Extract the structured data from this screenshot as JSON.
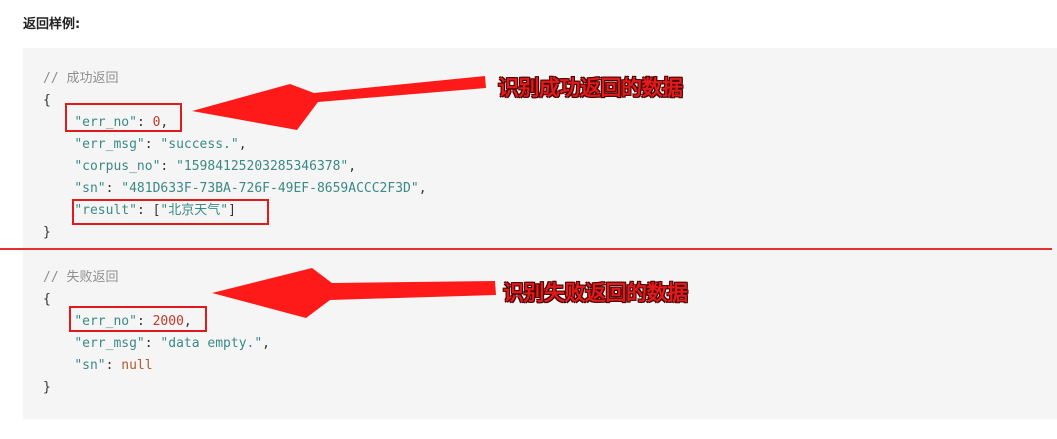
{
  "heading": "返回样例:",
  "success_block": {
    "comment": "// 成功返回",
    "open_brace": "{",
    "close_brace": "}",
    "err_no_key": "\"err_no\"",
    "err_no_value": "0",
    "err_msg_key": "\"err_msg\"",
    "err_msg_value": "\"success.\"",
    "corpus_no_key": "\"corpus_no\"",
    "corpus_no_value": "\"15984125203285346378\"",
    "sn_key": "\"sn\"",
    "sn_value": "\"481D633F-73BA-726F-49EF-8659ACCC2F3D\"",
    "result_key": "\"result\"",
    "result_open": "[",
    "result_value": "\"北京天气\"",
    "result_close": "]"
  },
  "failure_block": {
    "comment": "// 失败返回",
    "open_brace": "{",
    "close_brace": "}",
    "err_no_key": "\"err_no\"",
    "err_no_value": "2000",
    "err_msg_key": "\"err_msg\"",
    "err_msg_value": "\"data empty.\"",
    "sn_key": "\"sn\"",
    "sn_value": "null"
  },
  "annotations": {
    "success": "识别成功返回的数据",
    "failure": "识别失败返回的数据"
  },
  "colors": {
    "accent_red": "#e11b1b",
    "panel_bg": "#f5f5f5",
    "key_color": "#3a8a87",
    "number_color": "#c0392b"
  }
}
